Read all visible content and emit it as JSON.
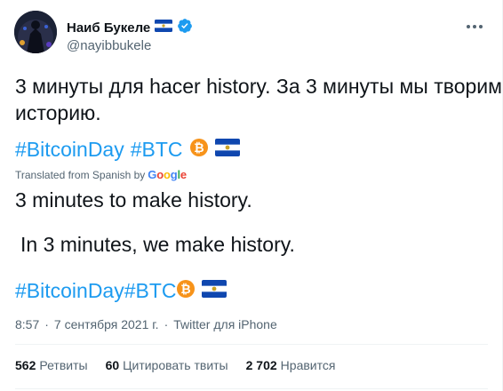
{
  "author": {
    "name": "Наиб Букеле",
    "handle": "@nayibbukele",
    "verified": true
  },
  "tweet": {
    "text_line1": "3 минуты для hacer history. За 3 минуты мы творим",
    "text_line2": "историю.",
    "hashtag1": "#BitcoinDay",
    "hashtag2": "#BTC"
  },
  "translation": {
    "label": "Translated from Spanish by",
    "provider": "Google",
    "line1": "3 minutes to make history.",
    "line2": "In 3 minutes, we make history.",
    "hashtag1": "#BitcoinDay",
    "hashtag2": "#BTC"
  },
  "meta": {
    "time": "8:57",
    "date": "7 сентября 2021 г.",
    "separator": "·",
    "source": "Twitter для iPhone"
  },
  "stats": {
    "retweets_count": "562",
    "retweets_label": "Ретвиты",
    "quotes_count": "60",
    "quotes_label": "Цитировать твиты",
    "likes_count": "2 702",
    "likes_label": "Нравится"
  },
  "icons": {
    "more": "more-icon",
    "verified": "verified-badge-icon",
    "bitcoin": "bitcoin-emoji-icon",
    "flag": "el-salvador-flag-icon"
  },
  "colors": {
    "accent": "#1d9bf0",
    "text": "#0f1419",
    "secondary": "#536471",
    "bitcoin": "#f7931a",
    "flag_blue": "#0f47af"
  }
}
